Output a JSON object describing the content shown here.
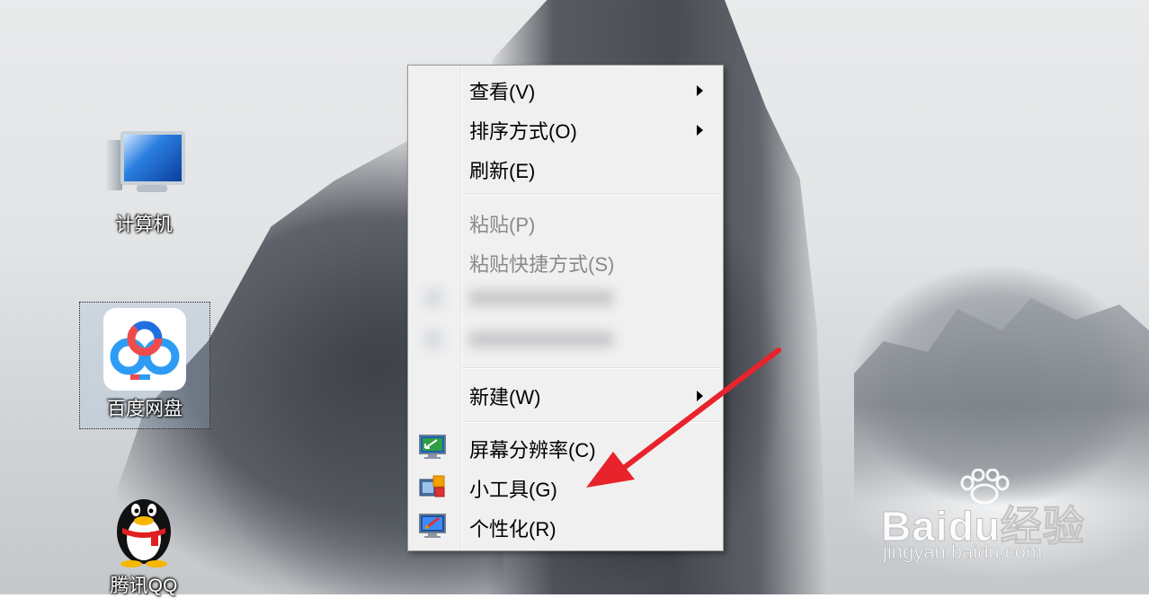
{
  "desktop": {
    "icons": [
      {
        "label": "计算机"
      },
      {
        "label": "百度网盘"
      },
      {
        "label": "腾讯QQ"
      }
    ]
  },
  "context_menu": {
    "items": {
      "view": {
        "label": "查看(V)",
        "has_submenu": true
      },
      "sort_by": {
        "label": "排序方式(O)",
        "has_submenu": true
      },
      "refresh": {
        "label": "刷新(E)"
      },
      "paste": {
        "label": "粘贴(P)",
        "disabled": true
      },
      "paste_shortcut": {
        "label": "粘贴快捷方式(S)",
        "disabled": true
      },
      "new": {
        "label": "新建(W)",
        "has_submenu": true
      },
      "screen_resolution": {
        "label": "屏幕分辨率(C)",
        "icon": "monitor-resolution-icon"
      },
      "gadgets": {
        "label": "小工具(G)",
        "icon": "gadgets-icon"
      },
      "personalize": {
        "label": "个性化(R)",
        "icon": "personalize-icon"
      }
    }
  },
  "watermark": {
    "brand": "Baidu经验",
    "url": "jingyan.baidu.com"
  },
  "colors": {
    "annotation_arrow": "#e8232b",
    "menu_background": "#f0f0f0"
  }
}
